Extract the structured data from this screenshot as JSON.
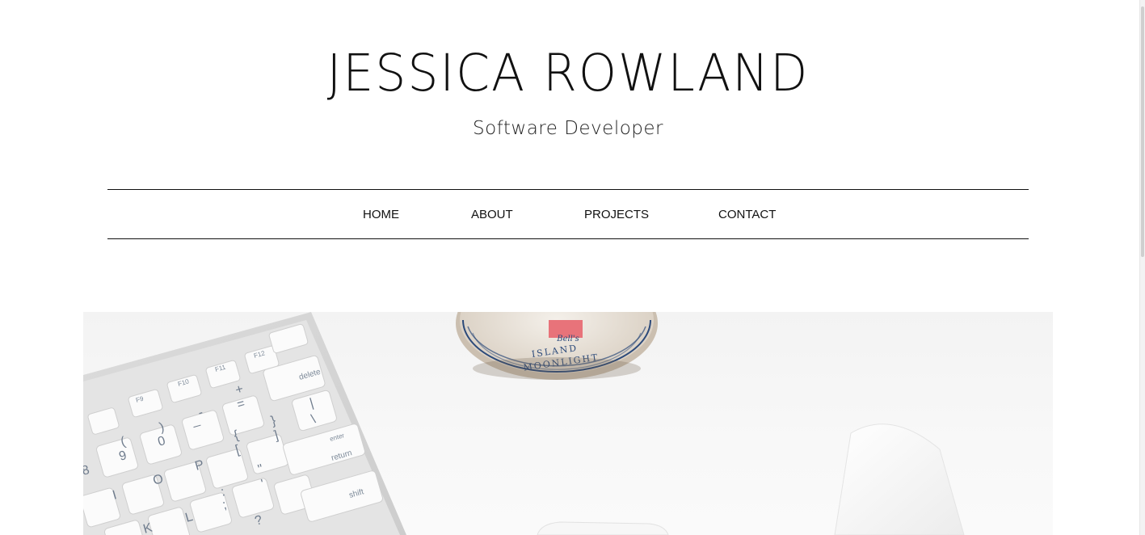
{
  "header": {
    "title": "JESSICA ROWLAND",
    "subtitle": "Software Developer"
  },
  "nav": {
    "items": [
      {
        "label": "HOME"
      },
      {
        "label": "ABOUT"
      },
      {
        "label": "PROJECTS"
      },
      {
        "label": "CONTACT"
      }
    ]
  },
  "hero": {
    "mug_text_line1": "Bell's",
    "mug_text_line2": "ISLAND",
    "mug_text_line3": "MOONLIGHT",
    "keys": {
      "delete": "delete",
      "enter": "enter",
      "return": "return",
      "shift": "shift",
      "f11": "F11",
      "f12": "F12",
      "f10": "F10",
      "f9": "F9",
      "k0": "0",
      "k9": "9",
      "k8": "8",
      "kP": "P",
      "kO": "O",
      "kI": "I",
      "kL": "L",
      "kK": "K",
      "kMinus": "-",
      "kPlus": "+",
      "kEq": "=",
      "kBraceOpen": "{",
      "kBraceClose": "}",
      "kBracketOpen": "[",
      "kBracketClose": "]",
      "kPipe": "|",
      "kBackslash": "\\",
      "kQuote": "\"",
      "kApos": "'",
      "kColon": ":",
      "kSemi": ";",
      "kQuestion": "?",
      "kUnderscore": "_",
      "kParenOpen": "(",
      "kParenClose": ")"
    }
  },
  "colors": {
    "text": "#111111",
    "mug_label": "#e8737a",
    "mug_stripes": "#2c4a7a"
  }
}
